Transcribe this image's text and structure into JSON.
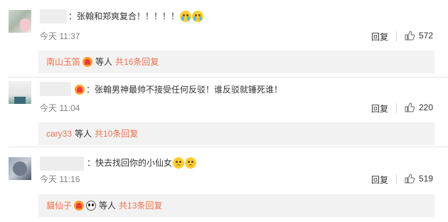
{
  "comments": [
    {
      "text": "：张翰和郑爽复合！！！！！",
      "time": "今天 11:37",
      "reply_label": "回复",
      "likes": "572",
      "sub": {
        "user": "南山玉笛",
        "suffix": "等人",
        "count_text": "共16条回复"
      }
    },
    {
      "text": "：张翰男神最帅不接受任何反驳！谁反驳就锤死谁！",
      "time": "今天 11:04",
      "reply_label": "回复",
      "likes": "220",
      "sub": {
        "user": "cary33",
        "suffix": "等人",
        "count_text": "共10条回复"
      }
    },
    {
      "text": "：快去找回你的小仙女",
      "time": "今天 11:16",
      "reply_label": "回复",
      "likes": "519",
      "sub": {
        "user": "貓仙子",
        "suffix": "等人",
        "count_text": "共13条回复"
      }
    }
  ],
  "icons": {
    "like": "thumbs-up-icon",
    "emoji_cry": "crying-face-icon",
    "emoji_worried": "worried-face-icon",
    "badge": "vip-badge-icon",
    "panda": "panda-icon"
  },
  "colors": {
    "username": "#eb7350",
    "sub_bg": "#f2f2f2",
    "time": "#808080"
  }
}
